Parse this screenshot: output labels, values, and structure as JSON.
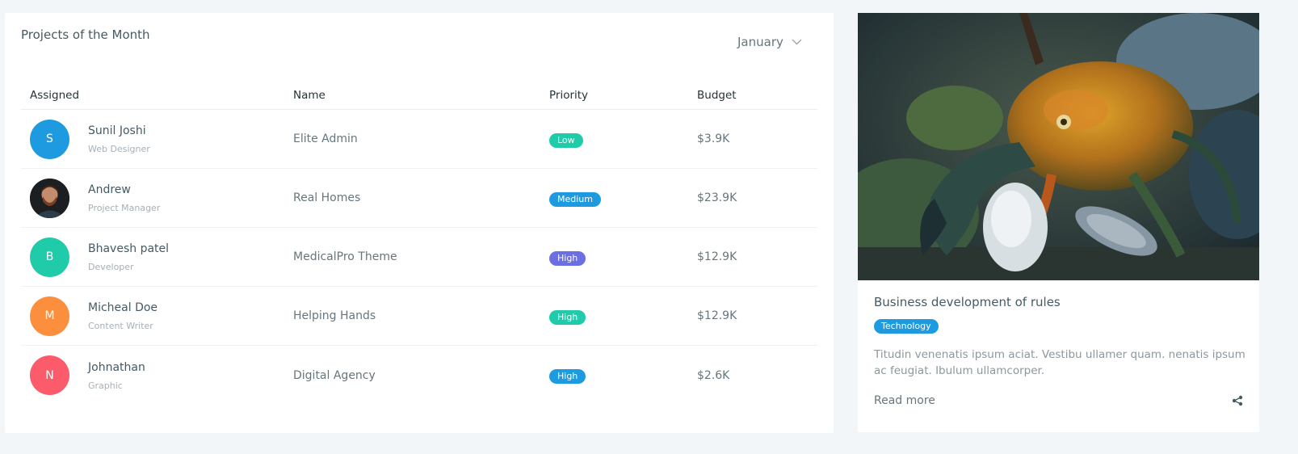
{
  "projects": {
    "title": "Projects of the Month",
    "month_selected": "January",
    "columns": [
      "Assigned",
      "Name",
      "Priority",
      "Budget"
    ],
    "rows": [
      {
        "initial": "S",
        "avatar_color": "#1e9be0",
        "name": "Sunil Joshi",
        "role": "Web Designer",
        "project": "Elite Admin",
        "priority": "Low",
        "priority_color": "#1fcba9",
        "budget": "$3.9K"
      },
      {
        "initial": "",
        "avatar_color": "#2b2b2b",
        "name": "Andrew",
        "role": "Project Manager",
        "project": "Real Homes",
        "priority": "Medium",
        "priority_color": "#1e9be0",
        "budget": "$23.9K"
      },
      {
        "initial": "B",
        "avatar_color": "#20cba9",
        "name": "Bhavesh patel",
        "role": "Developer",
        "project": "MedicalPro Theme",
        "priority": "High",
        "priority_color": "#6c6fe1",
        "budget": "$12.9K"
      },
      {
        "initial": "M",
        "avatar_color": "#fc8f3e",
        "name": "Micheal Doe",
        "role": "Content Writer",
        "project": "Helping Hands",
        "priority": "High",
        "priority_color": "#1fcba9",
        "budget": "$12.9K"
      },
      {
        "initial": "N",
        "avatar_color": "#fb5b6b",
        "name": "Johnathan",
        "role": "Graphic",
        "project": "Digital Agency",
        "priority": "High",
        "priority_color": "#1e9be0",
        "budget": "$2.6K"
      }
    ]
  },
  "blog": {
    "title": "Business development of rules",
    "tag": "Technology",
    "excerpt": "Titudin venenatis ipsum aciat. Vestibu ullamer quam. nenatis ipsum ac feugiat. Ibulum ullamcorper.",
    "read_more": "Read more",
    "image_icon": "crab-photo",
    "share_icon": "share-icon"
  }
}
